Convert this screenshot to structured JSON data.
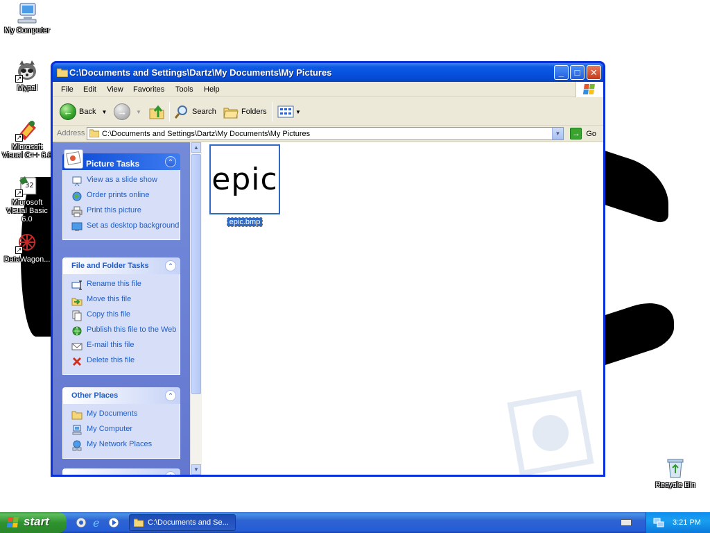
{
  "desktop": {
    "icons": [
      {
        "label": "My Computer"
      },
      {
        "label": "Mypal"
      },
      {
        "label": "Microsoft Visual C++ 6.0"
      },
      {
        "label": "Microsoft Visual Basic 6.0"
      },
      {
        "label": "DataWagon..."
      },
      {
        "label": "Recycle Bin"
      }
    ]
  },
  "window": {
    "title": "C:\\Documents and Settings\\Dartz\\My Documents\\My Pictures",
    "menu": [
      "File",
      "Edit",
      "View",
      "Favorites",
      "Tools",
      "Help"
    ],
    "toolbar": {
      "back": "Back",
      "search": "Search",
      "folders": "Folders"
    },
    "address": {
      "label": "Address",
      "value": "C:\\Documents and Settings\\Dartz\\My Documents\\My Pictures",
      "go": "Go"
    },
    "taskpane": {
      "picture_tasks": {
        "title": "Picture Tasks",
        "items": [
          "View as a slide show",
          "Order prints online",
          "Print this picture",
          "Set as desktop background"
        ]
      },
      "file_tasks": {
        "title": "File and Folder Tasks",
        "items": [
          "Rename this file",
          "Move this file",
          "Copy this file",
          "Publish this file to the Web",
          "E-mail this file",
          "Delete this file"
        ]
      },
      "other_places": {
        "title": "Other Places",
        "items": [
          "My Documents",
          "My Computer",
          "My Network Places"
        ]
      }
    },
    "files": [
      {
        "name": "epic.bmp",
        "thumbnail_text": "epic",
        "selected": true
      }
    ]
  },
  "taskbar": {
    "start": "start",
    "task_button": "C:\\Documents and Se...",
    "clock": "3:21 PM"
  },
  "colors": {
    "link": "#215dc6",
    "selection": "#316ac5",
    "taskbar": "#245dd7",
    "start": "#2f922f"
  }
}
